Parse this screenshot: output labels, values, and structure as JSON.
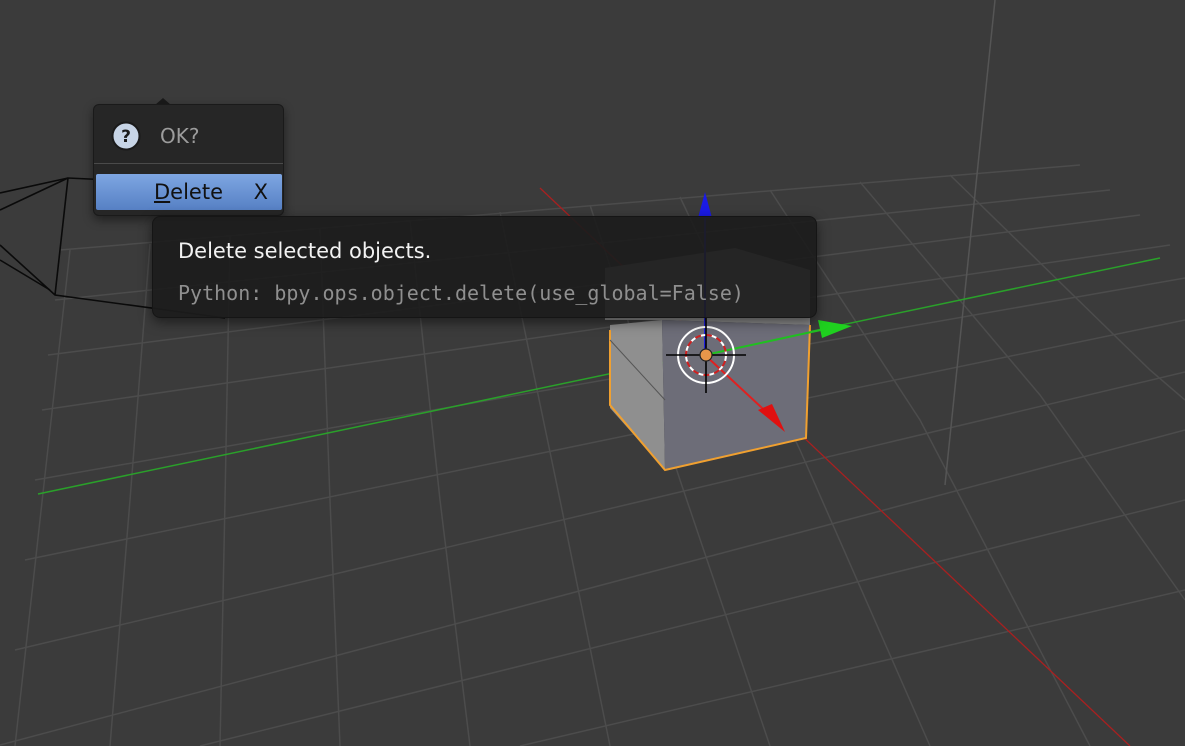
{
  "confirm_popup": {
    "title": "OK?",
    "icon": "question-icon",
    "delete_item": {
      "underlined_letter": "D",
      "label_rest": "elete",
      "shortcut": "X"
    }
  },
  "tooltip": {
    "description": "Delete selected objects.",
    "python": "Python: bpy.ops.object.delete(use_global=False)"
  },
  "colors": {
    "background": "#3b3b3b",
    "grid_line": "#4d4d4d",
    "x_axis": "#b22222",
    "y_axis": "#2aa02a",
    "selection_outline": "#f0a030",
    "menu_highlight": "#6a93d6"
  }
}
